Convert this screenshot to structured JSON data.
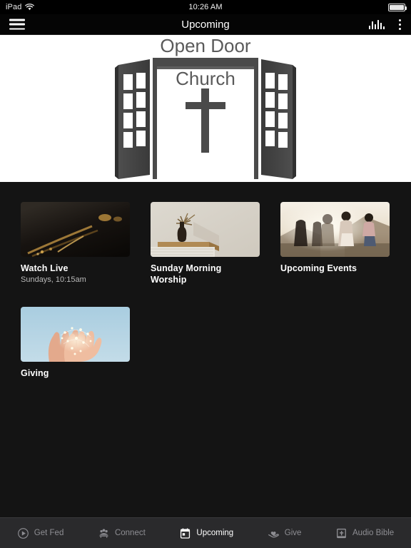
{
  "status_bar": {
    "device": "iPad",
    "wifi_icon": "wifi-icon",
    "time": "10:26 AM",
    "battery_icon": "battery-icon"
  },
  "nav": {
    "menu_icon": "hamburger-menu-icon",
    "title": "Upcoming",
    "equalizer_icon": "equalizer-icon",
    "overflow_icon": "kebab-menu-icon"
  },
  "logo": {
    "line1": "Open Door",
    "line2": "Church",
    "alt": "open-door-church-logo",
    "colors": {
      "door": "#4a4a4a",
      "door_dark": "#3c3c3c",
      "text": "#555555",
      "bg": "#ffffff"
    }
  },
  "cards": [
    {
      "title": "Watch Live",
      "subtitle": "Sundays, 10:15am",
      "image": "dark-brass-instruments-photo"
    },
    {
      "title": "Sunday Morning Worship",
      "subtitle": "",
      "image": "vase-with-dried-palm-photo"
    },
    {
      "title": "Upcoming Events",
      "subtitle": "",
      "image": "people-at-sunset-photo"
    },
    {
      "title": "Giving",
      "subtitle": "",
      "image": "hands-holding-fairy-lights-photo"
    }
  ],
  "tabs": [
    {
      "label": "Get Fed",
      "icon": "play-circle-icon",
      "active": false
    },
    {
      "label": "Connect",
      "icon": "people-group-icon",
      "active": false
    },
    {
      "label": "Upcoming",
      "icon": "calendar-icon",
      "active": true
    },
    {
      "label": "Give",
      "icon": "heart-in-hand-icon",
      "active": false
    },
    {
      "label": "Audio Bible",
      "icon": "bible-book-icon",
      "active": false
    }
  ],
  "theme": {
    "background": "#141414",
    "navbar": "#050505",
    "tabbar": "#2a2a2c",
    "active_tab": "#ffffff",
    "inactive_tab": "#8e8e93"
  }
}
